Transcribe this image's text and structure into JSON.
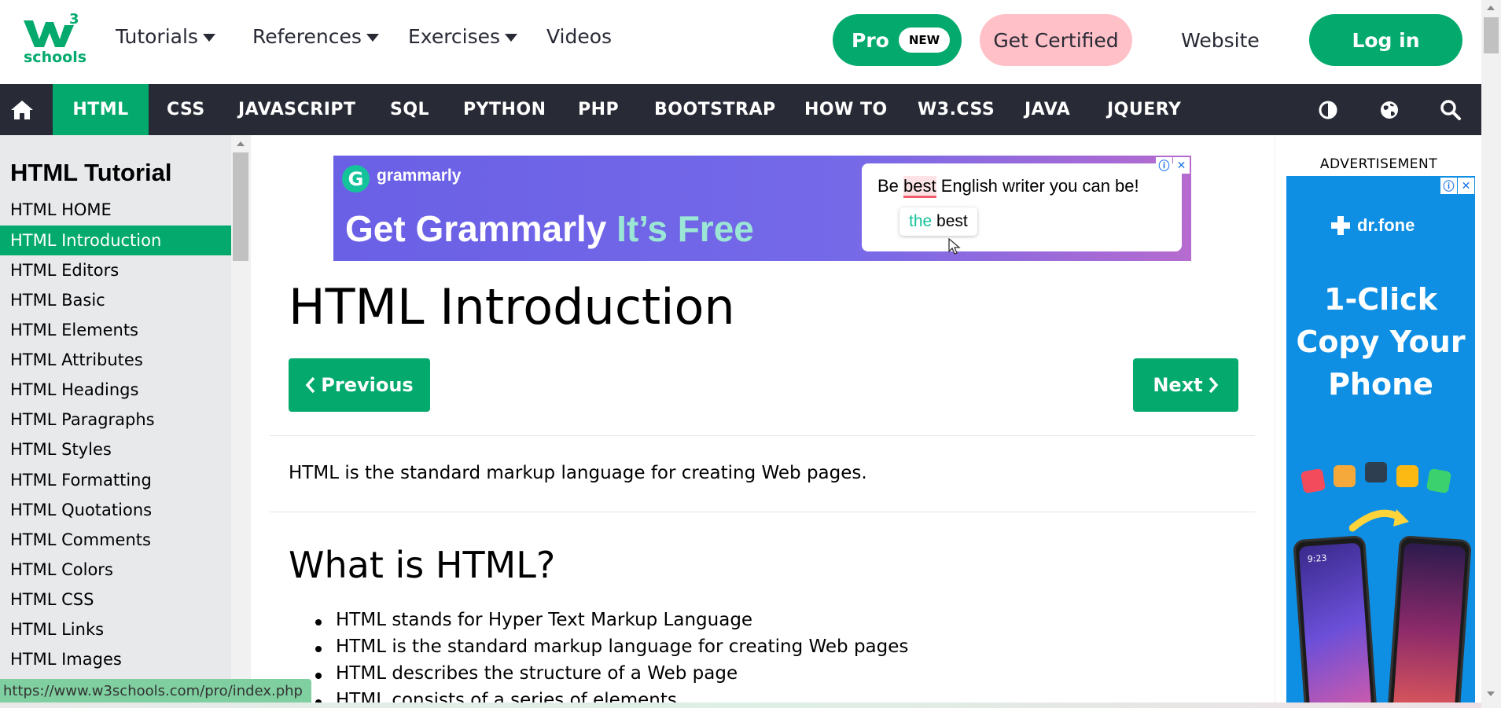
{
  "topbar": {
    "logo_text": "schools",
    "menus": [
      {
        "label": "Tutorials"
      },
      {
        "label": "References"
      },
      {
        "label": "Exercises"
      },
      {
        "label": "Videos"
      }
    ],
    "pro_label": "Pro",
    "pro_badge": "NEW",
    "certified_label": "Get Certified",
    "website_label": "Website",
    "login_label": "Log in"
  },
  "navbar": {
    "items": [
      "HTML",
      "CSS",
      "JAVASCRIPT",
      "SQL",
      "PYTHON",
      "PHP",
      "BOOTSTRAP",
      "HOW TO",
      "W3.CSS",
      "JAVA",
      "JQUERY"
    ],
    "active": "HTML",
    "icons": [
      "home-icon",
      "contrast-icon",
      "globe-icon",
      "search-icon"
    ]
  },
  "sidebar": {
    "title": "HTML Tutorial",
    "items": [
      "HTML HOME",
      "HTML Introduction",
      "HTML Editors",
      "HTML Basic",
      "HTML Elements",
      "HTML Attributes",
      "HTML Headings",
      "HTML Paragraphs",
      "HTML Styles",
      "HTML Formatting",
      "HTML Quotations",
      "HTML Comments",
      "HTML Colors",
      "HTML CSS",
      "HTML Links",
      "HTML Images"
    ],
    "active_item": "HTML Introduction"
  },
  "ad_banner": {
    "brand": "grammarly",
    "headline_a": "Get Grammarly ",
    "headline_b": "It’s Free",
    "card_pre": "Be ",
    "card_mark": "best",
    "card_post": " English writer you can be!",
    "chip_a": "the",
    "chip_b": " best"
  },
  "main": {
    "title": "HTML Introduction",
    "prev_label": "Previous",
    "next_label": "Next",
    "intro": "HTML is the standard markup language for creating Web pages.",
    "section_heading": "What is HTML?",
    "bullets": [
      "HTML stands for Hyper Text Markup Language",
      "HTML is the standard markup language for creating Web pages",
      "HTML describes the structure of a Web page",
      "HTML consists of a series of elements"
    ]
  },
  "right_ad": {
    "label": "ADVERTISEMENT",
    "brand": "dr.fone",
    "line1": "1-Click",
    "line2": "Copy Your",
    "line3": "Phone",
    "phone_time": "9:23"
  },
  "status_url": "https://www.w3schools.com/pro/index.php",
  "colors": {
    "accent": "#04AA6D",
    "nav_dark": "#282A35",
    "certified_pink": "#FFC0C7",
    "sidebar_bg": "#E7E9EB"
  }
}
